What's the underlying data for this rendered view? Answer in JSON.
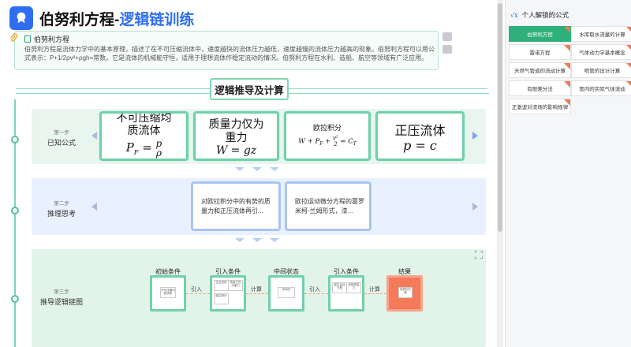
{
  "header": {
    "title_main": "伯努利方程-",
    "title_sub": "逻辑链训练"
  },
  "intro": {
    "heading": "伯努利方程",
    "text": "伯努利方程是流体力学中的基本原理，描述了在不可压缩流体中，速度越快的流体压力越低，速度越慢的流体压力越高的现象。伯努利方程可以用公式表示：P+1/2ρv²+ρgh=常数。它是流体的机械能守恒，适用于理想流体作稳定流动的情况。伯努利方程在水利、造船、航空等领域有广泛应用。"
  },
  "section": {
    "title": "逻辑推导及计算"
  },
  "step1": {
    "num": "第一步",
    "label": "已知公式",
    "cards": [
      {
        "line1": "不可压缩均",
        "line2": "质流体",
        "formula": "P_F = p/ρ"
      },
      {
        "line1": "质量力仅为",
        "line2": "重力",
        "formula": "W = gz"
      },
      {
        "line1": "欧拉积分",
        "formula": "W + P_F + v²/2 = C_T"
      },
      {
        "line1": "正压流体",
        "formula": "p = c"
      }
    ]
  },
  "step2": {
    "num": "第二步",
    "label": "推理思考",
    "cards": [
      {
        "text": "对欧拉积分中的有势的质量力和正压流体再引..."
      },
      {
        "text": "欧拉运动微分方程的葛罗米柯-兰姆形式，漆..."
      }
    ]
  },
  "step3": {
    "num": "第三步",
    "label": "推导逻辑链图",
    "nodes": [
      "初始条件",
      "引入条件",
      "中间状态",
      "引入条件",
      "结果"
    ],
    "connectors": [
      "引入",
      "计算",
      "引入",
      "计算"
    ],
    "mini_texts": [
      "不可压缩均质流体",
      "正压流体",
      "质量力仅为重力",
      "欧拉积分",
      "中间式",
      "欧拉运动方程",
      "有势质量力",
      "伯努利方程"
    ]
  },
  "sidebar": {
    "title": "个人解锁的公式",
    "items": [
      {
        "label": "伯努利方程",
        "active": true,
        "badge": true
      },
      {
        "label": "水库取水流量的计算",
        "active": false,
        "badge": true
      },
      {
        "label": "雷诺方程",
        "active": false,
        "badge": true
      },
      {
        "label": "气体动力学基本概念",
        "active": false,
        "badge": true
      },
      {
        "label": "天然气管道的流动计算",
        "active": false,
        "badge": true
      },
      {
        "label": "喷管的设计计算",
        "active": false,
        "badge": true
      },
      {
        "label": "有限差分法",
        "active": false,
        "badge": true
      },
      {
        "label": "管内的实际气体流动",
        "active": false,
        "badge": true
      },
      {
        "label": "正激波对流场的影响规律",
        "active": false,
        "badge": true
      }
    ]
  },
  "colors": {
    "accent": "#2f6ef0",
    "green": "#2fb07a",
    "card_border_green": "#6fd1a9",
    "card_border_blue": "#a8c4f0",
    "result": "#f47a5a"
  }
}
